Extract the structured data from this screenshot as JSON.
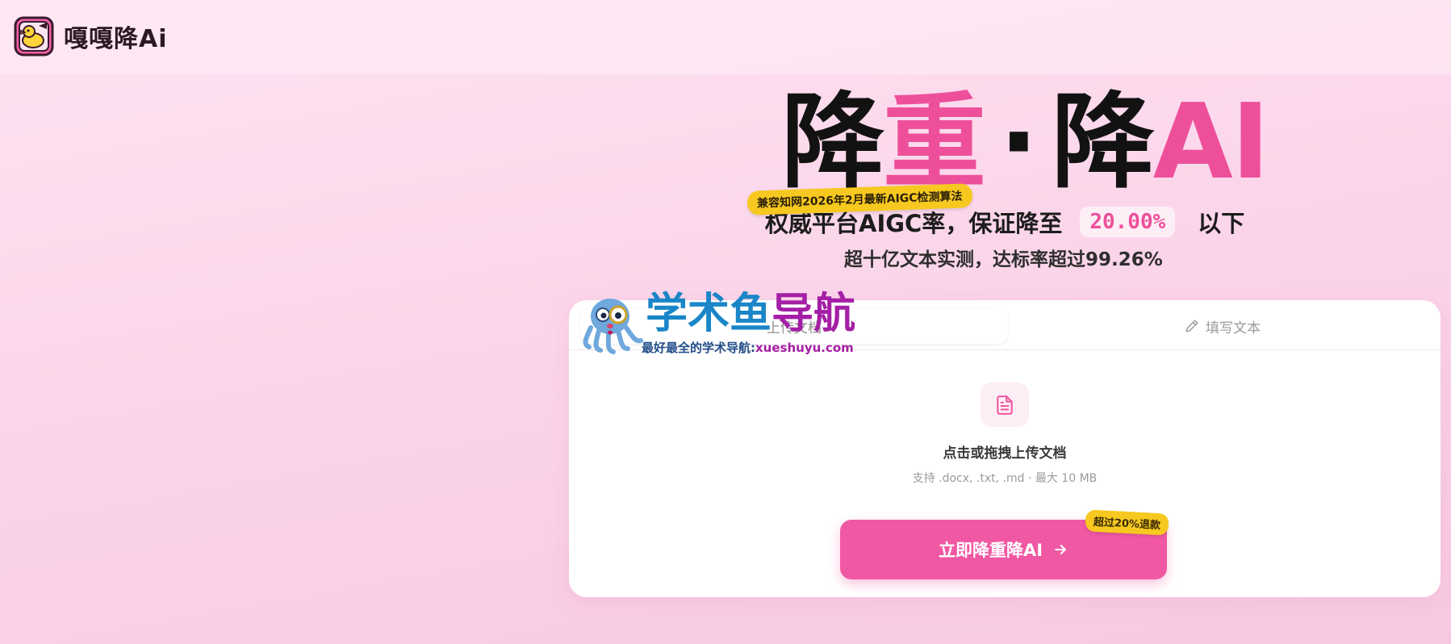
{
  "brand": {
    "name": "嘎嘎降Ai"
  },
  "hero": {
    "title_part1": "降",
    "title_part2": "重",
    "title_dot": "·",
    "title_part3": "降",
    "title_part4": "AI",
    "badge": "兼容知网2026年2月最新AIGC检测算法",
    "subtitle_prefix": "权威平台AIGC率，保证降至",
    "subtitle_rate": "20.00%",
    "subtitle_suffix": "以下",
    "subline": "超十亿文本实测，达标率超过99.26%"
  },
  "tabs": {
    "upload_label": "上传文档",
    "text_label": "填写文本"
  },
  "upload": {
    "title": "点击或拖拽上传文档",
    "hint": "支持 .docx, .txt, .md · 最大 10 MB"
  },
  "cta": {
    "label": "立即降重降AI",
    "badge": "超过20%退款"
  },
  "watermark": {
    "title_part1": "学术鱼",
    "title_part2": "导航",
    "subtitle": "最好最全的学术导航:",
    "url": "xueshuyu.com"
  },
  "colors": {
    "accent": "#f058a3",
    "title_pink": "#ee4f9b",
    "badge_yellow": "#f7c81f",
    "card_bg": "#ffffff"
  },
  "icons": {
    "logo": "duck-logo-icon",
    "file": "file-text-icon",
    "pen": "pen-icon",
    "arrow": "arrow-right-icon"
  }
}
